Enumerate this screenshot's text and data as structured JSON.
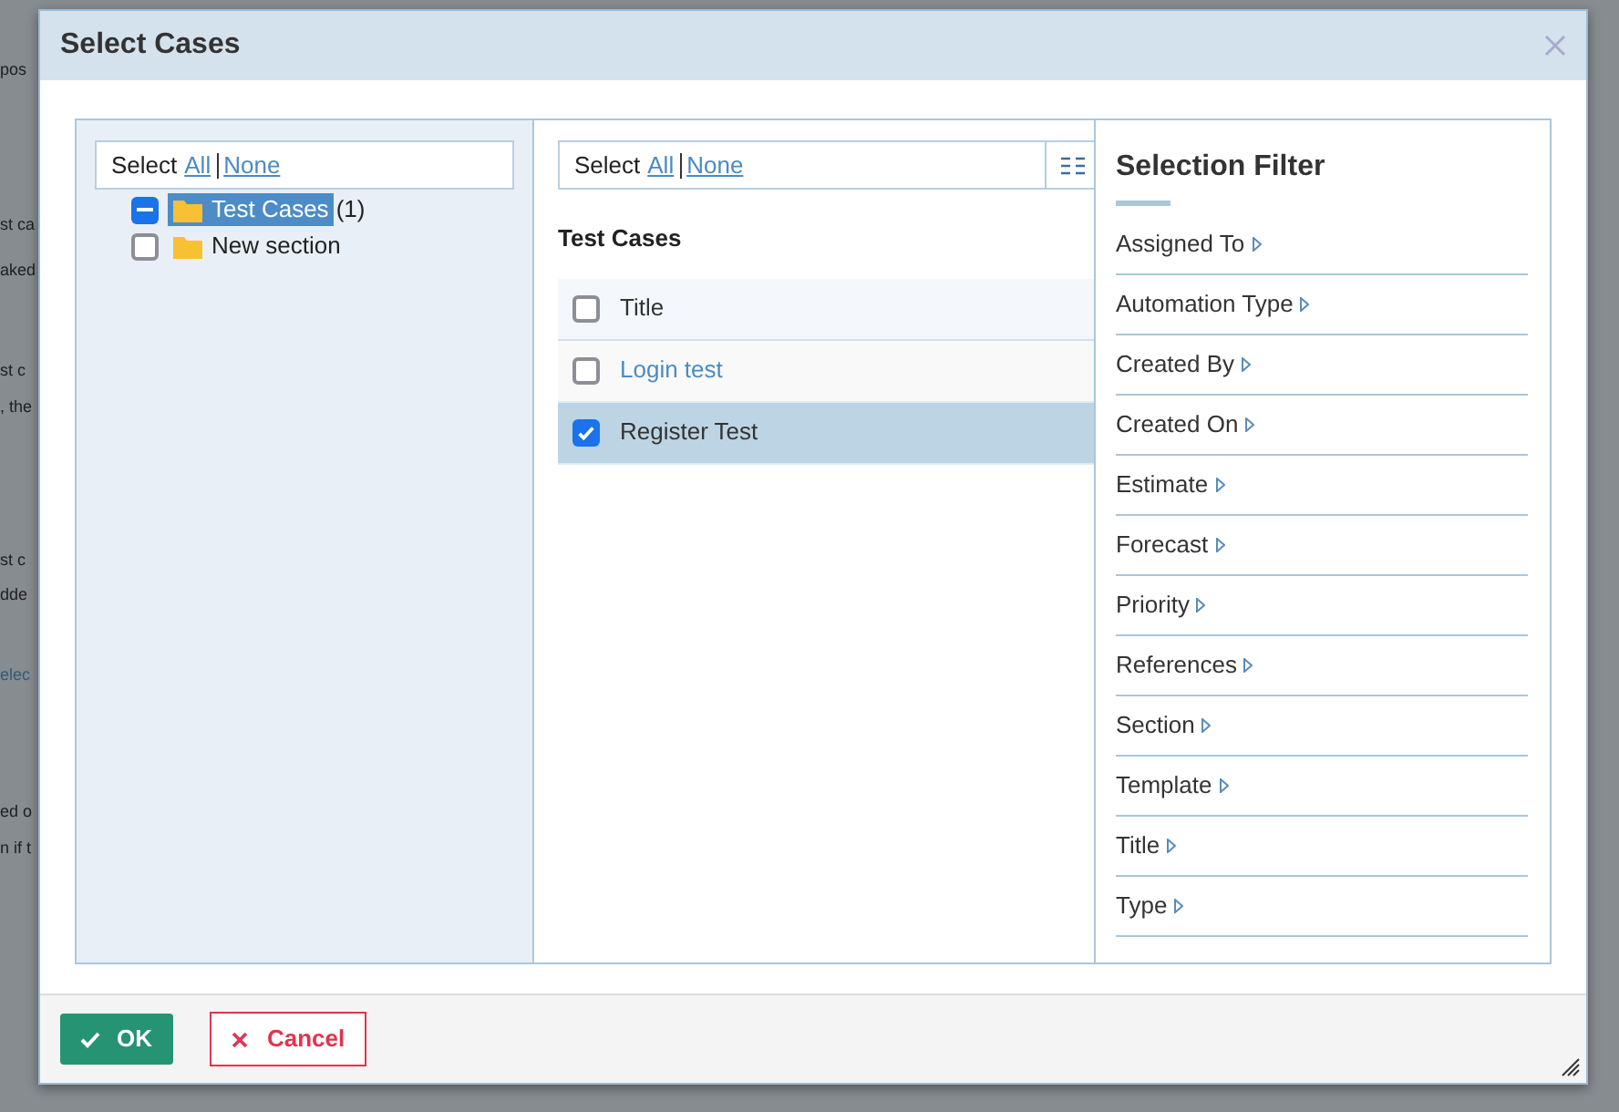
{
  "background_fragments": [
    {
      "text": "pos",
      "kind": "text"
    },
    {
      "text": "st ca",
      "kind": "text"
    },
    {
      "text": "aked",
      "kind": "text"
    },
    {
      "text": "st c",
      "kind": "text"
    },
    {
      "text": ", the",
      "kind": "text"
    },
    {
      "text": "st c",
      "kind": "text"
    },
    {
      "text": "dde",
      "kind": "text"
    },
    {
      "text": "elec",
      "kind": "link"
    },
    {
      "text": "ed o",
      "kind": "text"
    },
    {
      "text": "n if t",
      "kind": "text"
    }
  ],
  "dialog": {
    "title": "Select Cases"
  },
  "tree": {
    "select_label": "Select",
    "all_link": "All",
    "none_link": "None",
    "items": [
      {
        "label": "Test Cases",
        "count": "(1)",
        "partially_checked": true,
        "selected": true
      },
      {
        "label": "New section",
        "partially_checked": false,
        "selected": false
      }
    ]
  },
  "cases": {
    "select_label": "Select",
    "all_link": "All",
    "none_link": "None",
    "section_title": "Test Cases",
    "header": {
      "label": "Title",
      "checked": false
    },
    "rows": [
      {
        "title": "Login test",
        "checked": false,
        "selected": false
      },
      {
        "title": "Register Test",
        "checked": true,
        "selected": true
      }
    ]
  },
  "selection_filter": {
    "title": "Selection Filter",
    "items": [
      "Assigned To",
      "Automation Type",
      "Created By",
      "Created On",
      "Estimate",
      "Forecast",
      "Priority",
      "References",
      "Section",
      "Template",
      "Title",
      "Type"
    ]
  },
  "buttons": [
    {
      "label": "OK",
      "kind": "primary"
    },
    {
      "label": "Cancel",
      "kind": "cancel"
    }
  ]
}
